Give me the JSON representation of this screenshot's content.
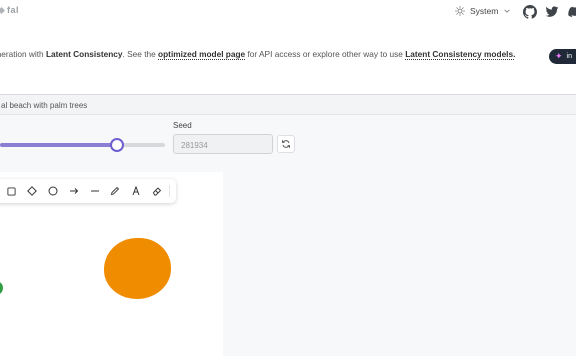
{
  "header": {
    "logo_text": "fal",
    "theme_label": "System"
  },
  "description": {
    "part1": "eneration with ",
    "bold1": "Latent Consistency",
    "part2": ". See the ",
    "link1": "optimized model page",
    "part3": " for API access or explore other way to use ",
    "link2": "Latent Consistency models.",
    "pill_text": "in"
  },
  "prompt": {
    "value": "al beach with palm trees"
  },
  "controls": {
    "slider_fraction": 0.7,
    "seed_label": "Seed",
    "seed_placeholder": "281934"
  },
  "colors": {
    "accent": "#8b7fd4",
    "orange_shape": "#f08c00",
    "green_shape": "#2f9e44"
  }
}
